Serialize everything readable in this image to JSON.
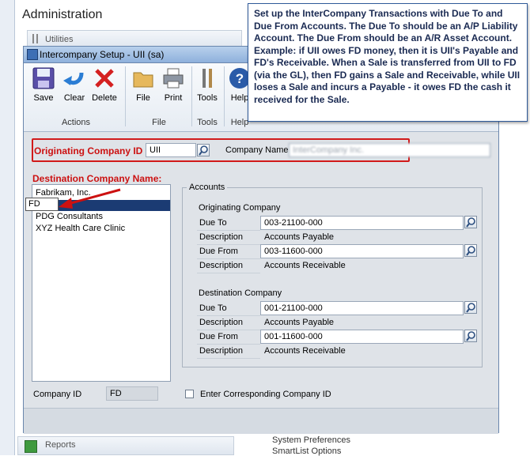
{
  "background": {
    "title": "Administration",
    "utilities": "Utilities",
    "reports": "Reports",
    "links": [
      "System Preferences",
      "SmartList Options"
    ]
  },
  "dialog": {
    "title": "Intercompany Setup  -  UII (sa)",
    "ribbon": {
      "actions": {
        "label": "Actions",
        "save": "Save",
        "clear": "Clear",
        "delete": "Delete"
      },
      "file": {
        "label": "File",
        "file": "File",
        "print": "Print"
      },
      "tools": {
        "label": "Tools",
        "tools": "Tools"
      },
      "help": {
        "label": "Help",
        "help": "Help"
      }
    },
    "originating": {
      "label": "Originating Company ID",
      "value": "UII",
      "company_name_label": "Company Name",
      "company_name_value": "InterCompany Inc."
    },
    "destination": {
      "label": "Destination Company Name:",
      "items": [
        "Fabrikam, Inc.",
        "",
        "PDG Consultants",
        "XYZ Health Care Clinic"
      ],
      "popup": "FD"
    },
    "accounts": {
      "title": "Accounts",
      "originating_title": "Originating Company",
      "destination_title": "Destination Company",
      "due_to_label": "Due To",
      "due_from_label": "Due From",
      "description_label": "Description",
      "orig_due_to": "003-21100-000",
      "orig_due_to_desc": "Accounts Payable",
      "orig_due_from": "003-11600-000",
      "orig_due_from_desc": "Accounts Receivable",
      "dest_due_to": "001-21100-000",
      "dest_due_to_desc": "Accounts Payable",
      "dest_due_from": "001-11600-000",
      "dest_due_from_desc": "Accounts Receivable"
    },
    "company_id_label": "Company ID",
    "company_id_value": "FD",
    "enter_corresponding": "Enter Corresponding Company ID"
  },
  "tooltip": {
    "text": "Set up the InterCompany Transactions with Due To and Due From Accounts. The Due To should be an A/P Liability Account. The Due From should be an A/R Asset Account. Example: if UII owes FD money, then it is UII's Payable and FD's Receivable. When a Sale is transferred from UII to FD (via the GL), then FD gains a Sale and Receivable, while UII loses a Sale and incurs a Payable - it owes FD the cash it received for the Sale."
  },
  "colors": {
    "highlight_red": "#d11a1a",
    "selection": "#1b3b73",
    "tooltip_text": "#1a2a52"
  }
}
